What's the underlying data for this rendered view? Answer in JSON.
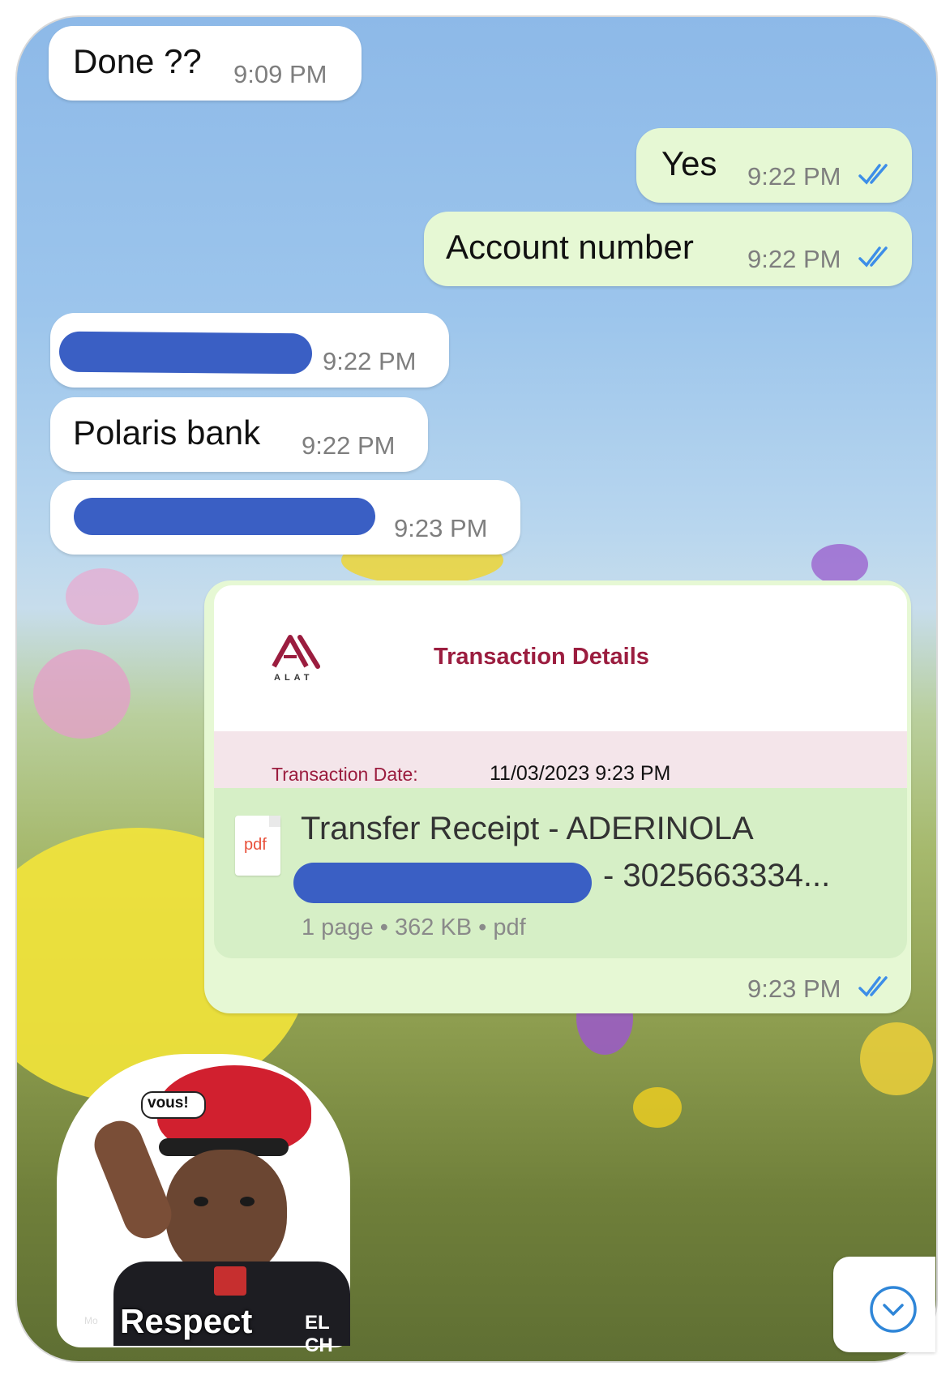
{
  "messages": [
    {
      "text": "Done ??",
      "time": "9:09 PM"
    },
    {
      "text": "Yes",
      "time": "9:22 PM"
    },
    {
      "text": "Account number",
      "time": "9:22 PM"
    },
    {
      "text": "",
      "time": "9:22 PM"
    },
    {
      "text": "Polaris bank",
      "time": "9:22 PM"
    },
    {
      "text": "",
      "time": "9:23 PM"
    }
  ],
  "receipt": {
    "logo_text": "ALAT",
    "header_title": "Transaction Details",
    "date_label": "Transaction Date:",
    "date_value": "11/03/2023 9:23 PM",
    "file_icon_label": "pdf",
    "file_name_line1": "Transfer Receipt - ADERINOLA",
    "file_name_line2_suffix": "- 3025663334...",
    "file_meta": "1 page • 362 KB • pdf",
    "time": "9:23 PM"
  },
  "sticker": {
    "speech": "vous!",
    "caption": "Respect",
    "corner_text": "EL CH",
    "small_text": "Mo"
  },
  "icons": {
    "read_receipt": "double-check-icon",
    "scroll_down": "chevron-down-circle-icon",
    "file": "pdf-file-icon"
  },
  "colors": {
    "incoming_bubble": "#ffffff",
    "outgoing_bubble": "#e6f8d4",
    "tick_blue": "#3d8ee8",
    "redaction": "#3a5fc4",
    "brand": "#9b1d3f"
  }
}
